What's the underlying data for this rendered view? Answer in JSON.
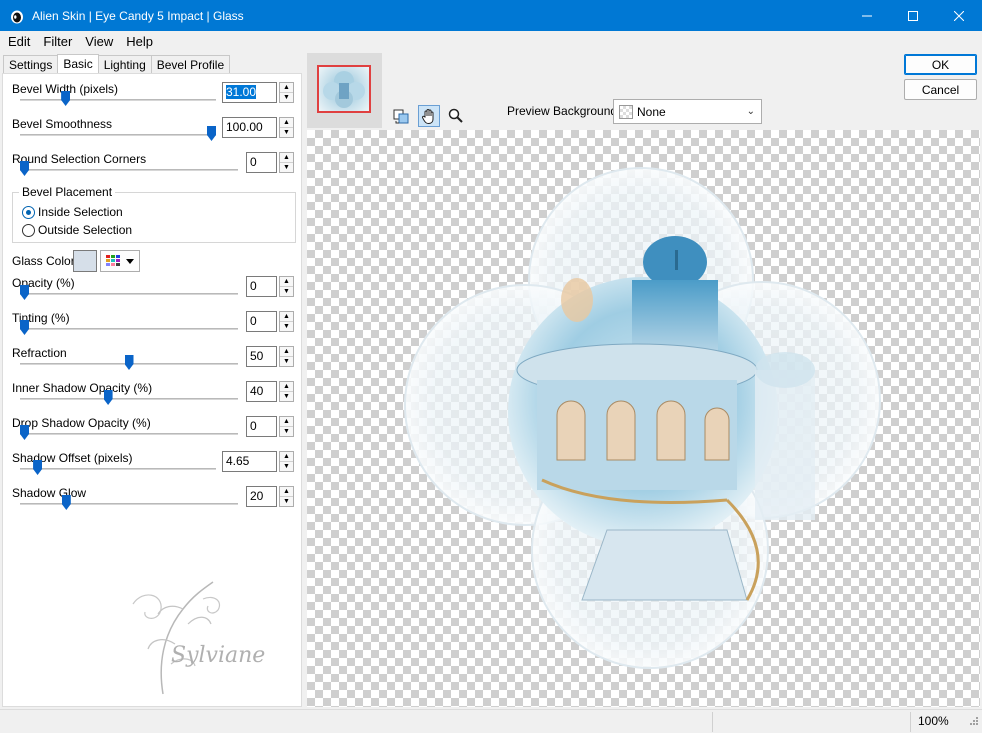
{
  "window": {
    "title": "Alien Skin | Eye Candy 5 Impact | Glass"
  },
  "menu": [
    "Edit",
    "Filter",
    "View",
    "Help"
  ],
  "tabs": [
    "Settings",
    "Basic",
    "Lighting",
    "Bevel Profile"
  ],
  "active_tab": "Basic",
  "params": {
    "bevel_width": {
      "label": "Bevel Width (pixels)",
      "value": "31.00",
      "level": 0.22
    },
    "bevel_smoothness": {
      "label": "Bevel Smoothness",
      "value": "100.00",
      "level": 1.0
    },
    "round_corners": {
      "label": "Round Selection Corners",
      "value": "0",
      "level": 0.0
    },
    "opacity": {
      "label": "Opacity (%)",
      "value": "0",
      "level": 0.0
    },
    "tinting": {
      "label": "Tinting (%)",
      "value": "0",
      "level": 0.0
    },
    "refraction": {
      "label": "Refraction",
      "value": "50",
      "level": 0.5
    },
    "inner_shadow": {
      "label": "Inner Shadow Opacity (%)",
      "value": "40",
      "level": 0.4
    },
    "drop_shadow": {
      "label": "Drop Shadow Opacity (%)",
      "value": "0",
      "level": 0.0
    },
    "shadow_offset": {
      "label": "Shadow Offset (pixels)",
      "value": "4.65",
      "level": 0.07
    },
    "shadow_glow": {
      "label": "Shadow Glow",
      "value": "20",
      "level": 0.2
    }
  },
  "bevel_placement": {
    "title": "Bevel Placement",
    "inside": "Inside Selection",
    "outside": "Outside Selection",
    "selected": "inside"
  },
  "glass_color": {
    "label": "Glass Color",
    "color": "#d6dfe9"
  },
  "watermark": {
    "text": "Sylviane"
  },
  "preview": {
    "background_label": "Preview Background:",
    "background_value": "None"
  },
  "buttons": {
    "ok": "OK",
    "cancel": "Cancel"
  },
  "status": {
    "zoom": "100%"
  },
  "colors": {
    "titlebar": "#0078d4",
    "accent": "#0a64c8"
  }
}
